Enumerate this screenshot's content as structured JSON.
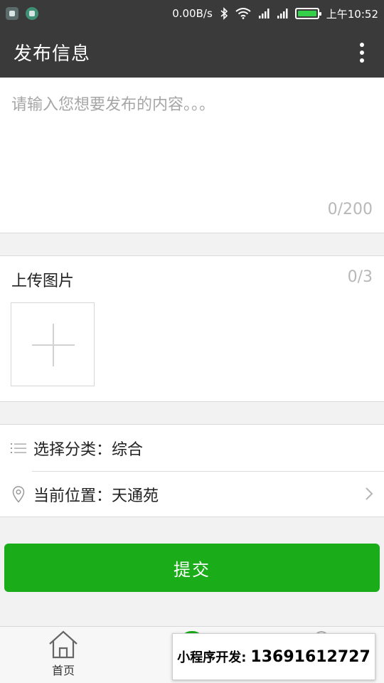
{
  "status_bar": {
    "network_speed": "0.00B/s",
    "time": "上午10:52",
    "icons": [
      "gallery-icon",
      "app-icon",
      "bluetooth-icon",
      "wifi-icon",
      "signal-icon",
      "signal-icon",
      "battery-icon"
    ],
    "battery_level": 1.0
  },
  "header": {
    "title": "发布信息",
    "more_icon": "more-vertical-icon"
  },
  "content_input": {
    "placeholder": "请输入您想要发布的内容。。。",
    "counter": "0/200"
  },
  "upload": {
    "label": "上传图片",
    "counter": "0/3",
    "add_icon": "plus-icon"
  },
  "options": {
    "category": {
      "icon": "list-icon",
      "label": "选择分类：",
      "value": "综合"
    },
    "location": {
      "icon": "location-pin-icon",
      "label": "当前位置：",
      "value": "天通苑",
      "arrow_icon": "chevron-right-icon"
    }
  },
  "submit": {
    "label": "提交"
  },
  "tab_bar": {
    "home": {
      "icon": "home-icon",
      "label": "首页"
    }
  },
  "watermark": {
    "label": "小程序开发:",
    "phone": "13691612727"
  },
  "colors": {
    "header_bg": "#3a3a3a",
    "accent_green": "#1aad19",
    "page_bg": "#f2f2f2"
  }
}
